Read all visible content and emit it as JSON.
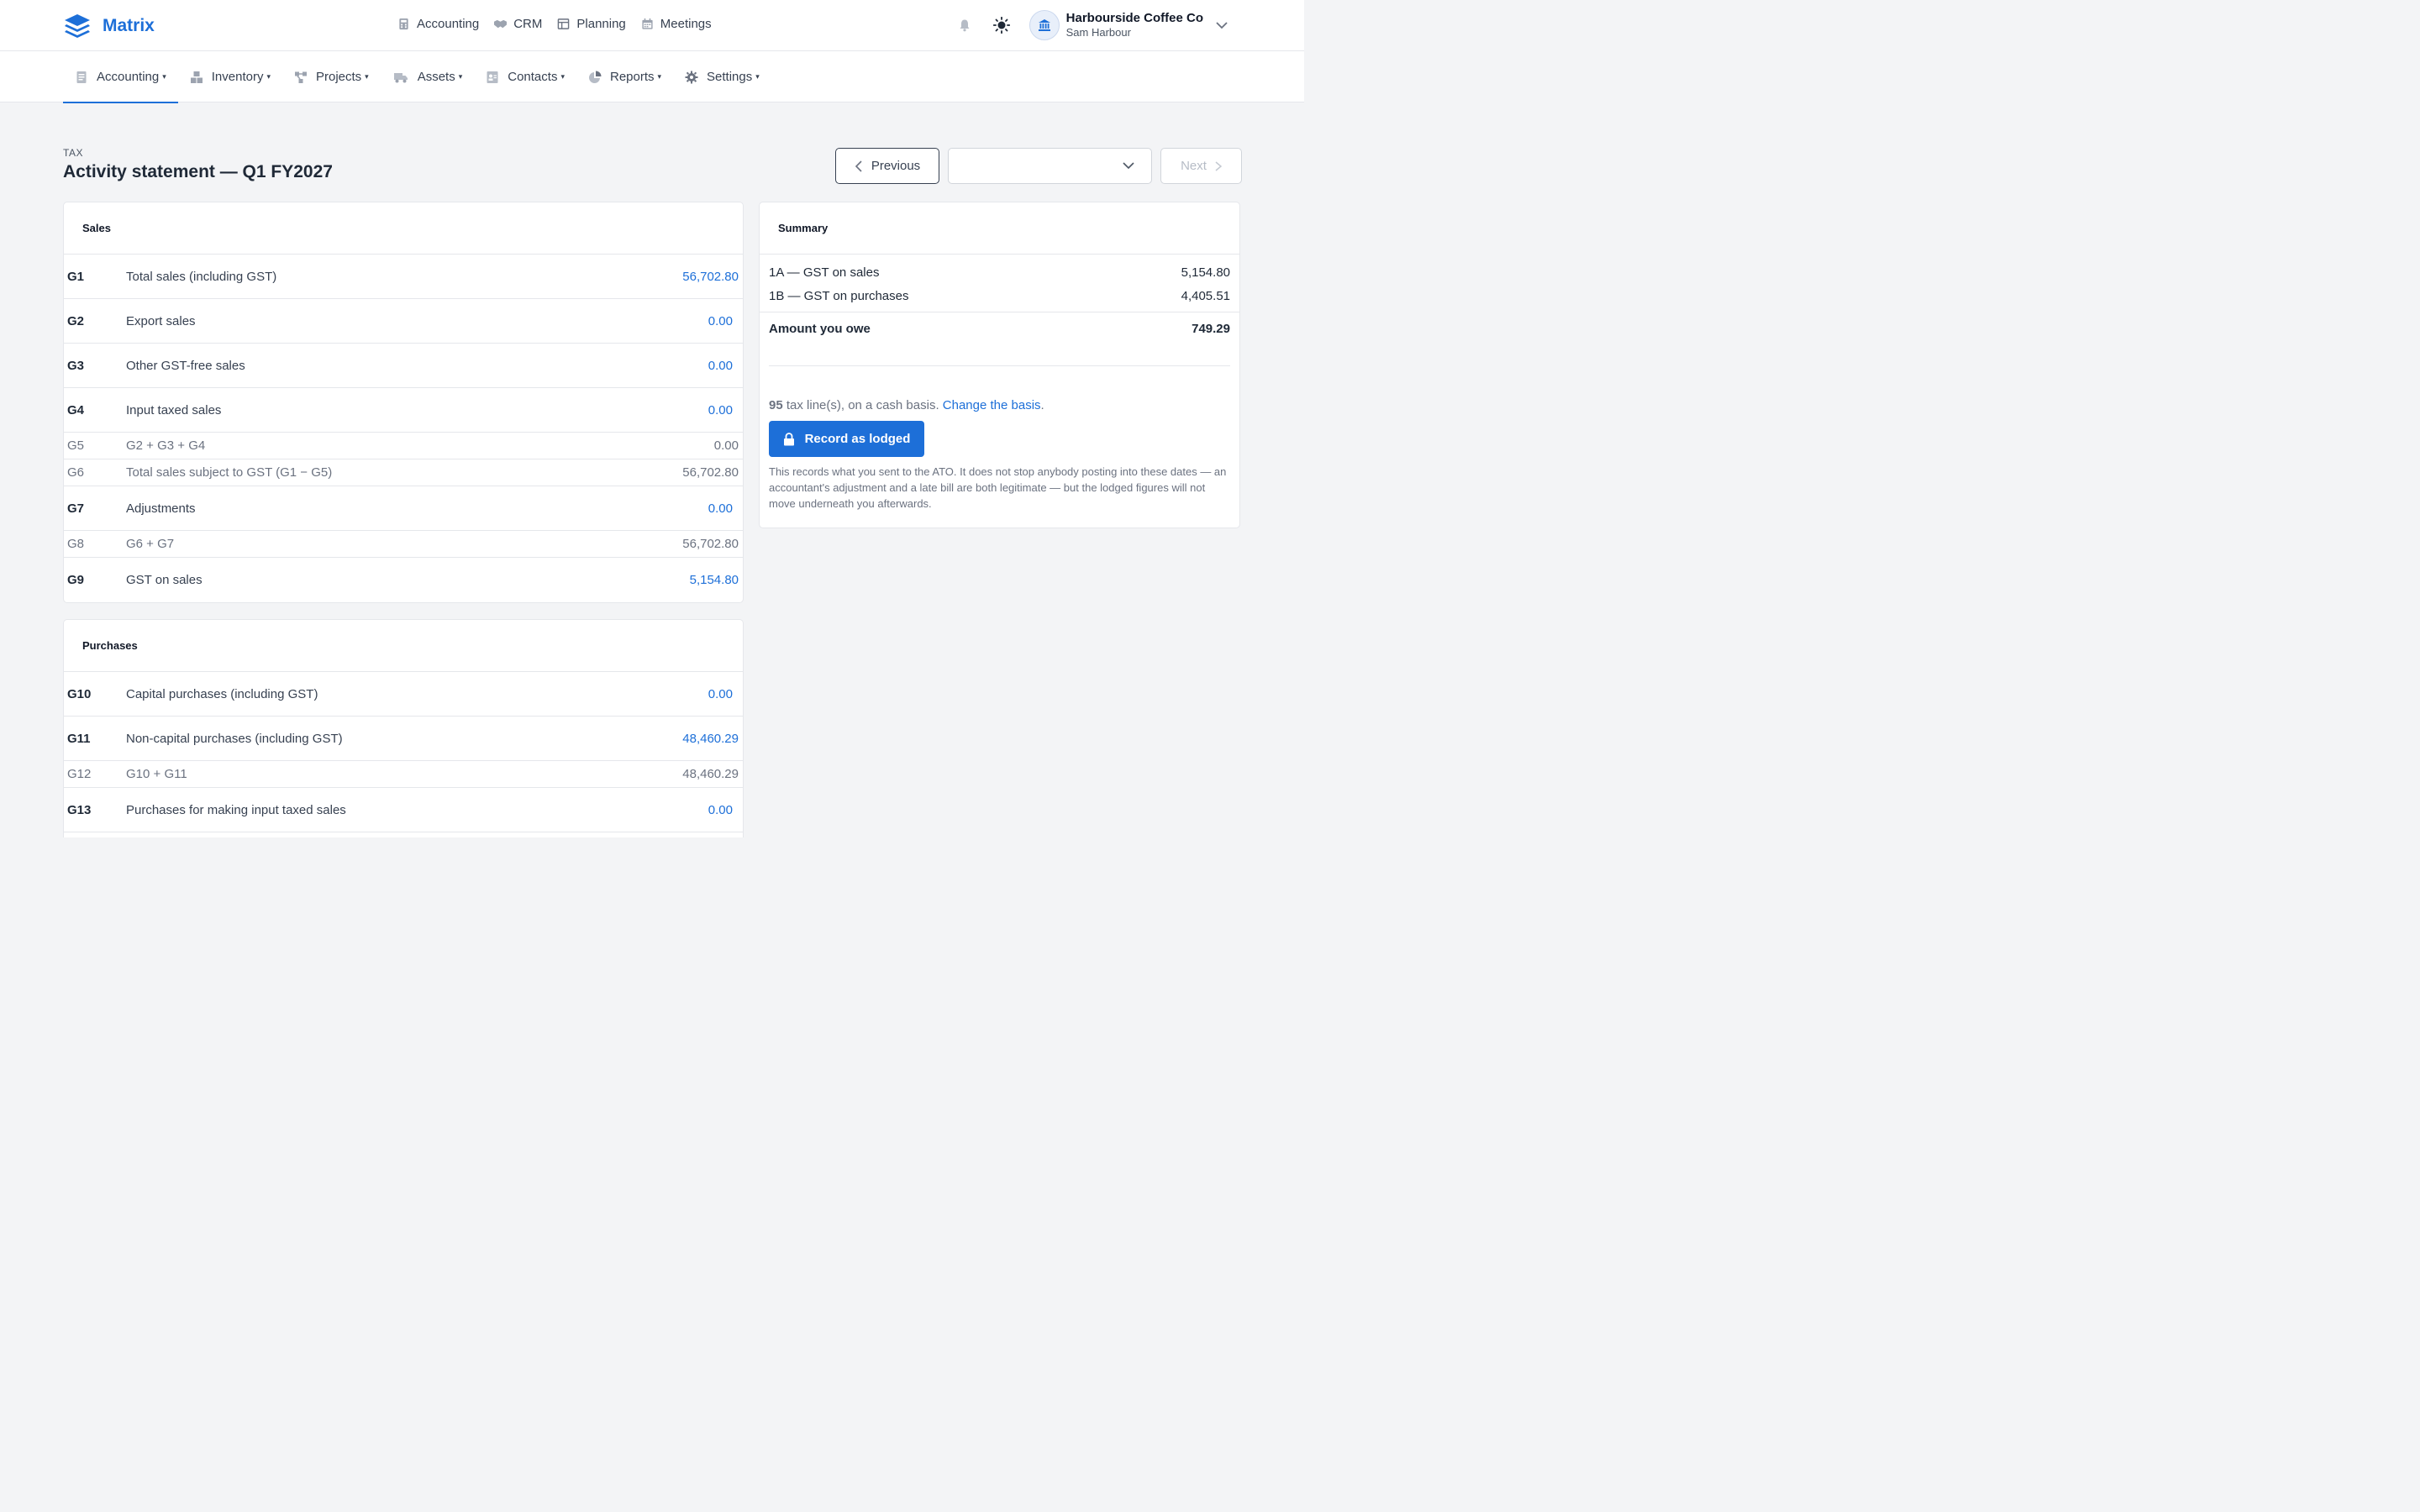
{
  "app": {
    "name": "Matrix"
  },
  "topnav": [
    {
      "label": "Accounting",
      "icon": "calculator-icon"
    },
    {
      "label": "CRM",
      "icon": "handshake-icon"
    },
    {
      "label": "Planning",
      "icon": "board-icon"
    },
    {
      "label": "Meetings",
      "icon": "calendar-icon"
    }
  ],
  "org": {
    "name": "Harbourside Coffee Co",
    "user": "Sam Harbour"
  },
  "subnav": [
    {
      "label": "Accounting",
      "icon": "ledger-icon",
      "active": true
    },
    {
      "label": "Inventory",
      "icon": "boxes-icon"
    },
    {
      "label": "Projects",
      "icon": "diagram-icon"
    },
    {
      "label": "Assets",
      "icon": "truck-icon"
    },
    {
      "label": "Contacts",
      "icon": "contact-card-icon"
    },
    {
      "label": "Reports",
      "icon": "pie-chart-icon"
    },
    {
      "label": "Settings",
      "icon": "gear-icon"
    }
  ],
  "page": {
    "eyebrow": "TAX",
    "title": "Activity statement — Q1 FY2027"
  },
  "pager": {
    "previous": "Previous",
    "next": "Next",
    "period_value": ""
  },
  "sales": {
    "title": "Sales",
    "rows": [
      {
        "code": "G1",
        "label": "Total sales (including GST)",
        "amount": "56,702.80"
      },
      {
        "code": "G2",
        "label": "Export sales",
        "amount": "0.00"
      },
      {
        "code": "G3",
        "label": "Other GST-free sales",
        "amount": "0.00"
      },
      {
        "code": "G4",
        "label": "Input taxed sales",
        "amount": "0.00"
      },
      {
        "code": "G5",
        "label": "G2 + G3 + G4",
        "amount": "0.00"
      },
      {
        "code": "G6",
        "label": "Total sales subject to GST (G1 − G5)",
        "amount": "56,702.80"
      },
      {
        "code": "G7",
        "label": "Adjustments",
        "amount": "0.00"
      },
      {
        "code": "G8",
        "label": "G6 + G7",
        "amount": "56,702.80"
      },
      {
        "code": "G9",
        "label": "GST on sales",
        "amount": "5,154.80"
      }
    ]
  },
  "purchases": {
    "title": "Purchases",
    "rows": [
      {
        "code": "G10",
        "label": "Capital purchases (including GST)",
        "amount": "0.00"
      },
      {
        "code": "G11",
        "label": "Non-capital purchases (including GST)",
        "amount": "48,460.29"
      },
      {
        "code": "G12",
        "label": "G10 + G11",
        "amount": "48,460.29"
      },
      {
        "code": "G13",
        "label": "Purchases for making input taxed sales",
        "amount": "0.00"
      }
    ]
  },
  "summary": {
    "title": "Summary",
    "gst_sales_label": "1A — GST on sales",
    "gst_sales_amount": "5,154.80",
    "gst_purchases_label": "1B — GST on purchases",
    "gst_purchases_amount": "4,405.51",
    "owe_label": "Amount you owe",
    "owe_amount": "749.29",
    "tax_line_count": "95",
    "basis_text": " tax line(s), on a cash basis. ",
    "basis_link": "Change the basis",
    "basis_end": ".",
    "lodge_button": "Record as lodged",
    "note": "This records what you sent to the ATO. It does not stop anybody posting into these dates — an accountant's adjustment and a late bill are both legitimate — but the lodged figures will not move underneath you afterwards."
  },
  "colors": {
    "accent": "#1d6fd8",
    "border": "#e5e7eb",
    "background": "#f3f4f6"
  }
}
